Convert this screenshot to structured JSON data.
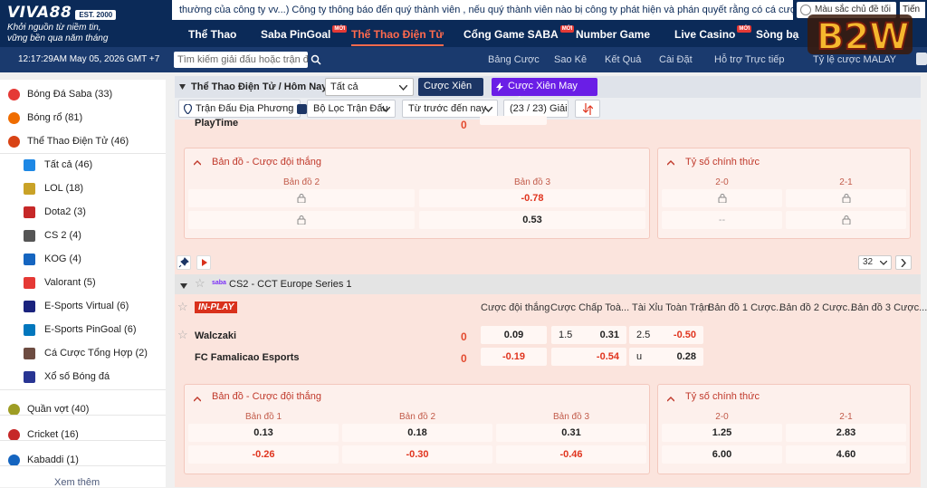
{
  "header": {
    "logo": "VIVA88",
    "logo_est": "EST. 2000",
    "tagline_1": "Khởi nguồn từ niềm tin,",
    "tagline_2": "vững bền qua năm tháng",
    "marquee": "thường của công ty vv...) Công ty thông báo đến quý thành viên , nếu quý thành viên nào bị công ty phát hiện và phán quyết rằng có cá cược bất",
    "mode_toggle": "Màu sắc chủ đề tối",
    "lang": "Tiến",
    "new_badge": "MỚI",
    "nav": [
      {
        "label": "Thể Thao",
        "new": false
      },
      {
        "label": "Saba PinGoal",
        "new": true
      },
      {
        "label": "Thể Thao Điện Tử",
        "new": false
      },
      {
        "label": "Cổng Game SABA",
        "new": true
      },
      {
        "label": "Number Game",
        "new": false
      },
      {
        "label": "Live Casino",
        "new": true
      },
      {
        "label": "Sòng bạ",
        "new": false
      }
    ]
  },
  "subbar": {
    "clock": "12:17:29AM May 05, 2026 GMT +7",
    "search_placeholder": "Tìm kiếm giải đấu hoặc trận đấu",
    "tools": [
      "Bảng Cược",
      "Sao Kê",
      "Kết Quả",
      "Cài Đặt",
      "Hỗ trợ Trực tiếp",
      "Tỷ lệ cược MALAY"
    ]
  },
  "emblem": {
    "text": "B2W"
  },
  "sidebar": {
    "items": [
      {
        "label": "Bóng Đá Saba (33)",
        "level": "top",
        "color": "#e53935"
      },
      {
        "label": "Bóng rổ (81)",
        "level": "top",
        "color": "#ef6c00"
      },
      {
        "label": "Thể Thao Điện Tử (46)",
        "level": "top",
        "color": "#d84315"
      },
      {
        "label": "Tất cả (46)",
        "level": "sub",
        "color": "#1e88e5"
      },
      {
        "label": "LOL (18)",
        "level": "sub",
        "color": "#c9a227"
      },
      {
        "label": "Dota2 (3)",
        "level": "sub",
        "color": "#c62828"
      },
      {
        "label": "CS 2 (4)",
        "level": "sub",
        "color": "#555555"
      },
      {
        "label": "KOG (4)",
        "level": "sub",
        "color": "#1565c0"
      },
      {
        "label": "Valorant (5)",
        "level": "sub",
        "color": "#e53935"
      },
      {
        "label": "E-Sports Virtual (6)",
        "level": "sub",
        "color": "#1a237e"
      },
      {
        "label": "E-Sports PinGoal (6)",
        "level": "sub",
        "color": "#0277bd"
      },
      {
        "label": "Cá Cược Tổng Hợp (2)",
        "level": "sub",
        "color": "#6d4c41"
      },
      {
        "label": "Xổ số Bóng đá",
        "level": "sub",
        "color": "#283593"
      },
      {
        "label": "Quần vợt (40)",
        "level": "top",
        "color": "#9e9d24"
      },
      {
        "label": "Cricket (16)",
        "level": "top",
        "color": "#c62828"
      },
      {
        "label": "Kabaddi (1)",
        "level": "top",
        "color": "#1565c0"
      }
    ],
    "see_more": "Xem thêm"
  },
  "main": {
    "breadcrumb": "Thể Thao Điện Tử / Hôm Nay",
    "filter_select": "Tất cả",
    "parlay_btn": "Cược Xiên",
    "lucky_parlay_btn": "Cược Xiên May Mắn",
    "filters": {
      "local": "Trận Đấu Địa Phương",
      "match_filter": "Bộ Lọc Trận Đấu",
      "sort": "Từ trước đến nay",
      "count": "(23 / 23) Giải"
    },
    "match1": {
      "team": "PlayTime",
      "score": "0",
      "card_map": {
        "title": "Bản đồ - Cược đội thắng",
        "heads": [
          "Bản đồ 2",
          "Bản đồ 3"
        ],
        "row1": [
          "",
          "-0.78"
        ],
        "row2": [
          "",
          "0.53"
        ]
      },
      "card_score": {
        "title": "Tỷ số chính thức",
        "heads": [
          "2-0",
          "2-1"
        ],
        "row1": [
          "",
          ""
        ],
        "row2": [
          "--",
          ""
        ]
      }
    },
    "pager": "32",
    "league": {
      "name": "CS2 - CCT Europe Series 1",
      "badge": "saba"
    },
    "match2": {
      "status": "IN-PLAY",
      "columns": [
        "Cược đội thắng",
        "Cược Chấp Toà...",
        "Tài Xỉu Toàn Trận",
        "Bản đồ 1 Cược...",
        "Bản đồ 2 Cược...",
        "Bản đồ 3 Cược..."
      ],
      "home": {
        "name": "Walczaki",
        "score": "0",
        "ml": "0.09",
        "hdp_line": "1.5",
        "hdp": "0.31",
        "ou_line": "2.5",
        "ou": "-0.50"
      },
      "away": {
        "name": "FC Famalicao Esports",
        "score": "0",
        "ml": "-0.19",
        "hdp_line": "",
        "hdp": "-0.54",
        "ou_line": "u",
        "ou": "0.28"
      },
      "card_map": {
        "title": "Bản đồ - Cược đội thắng",
        "heads": [
          "Bản đồ 1",
          "Bản đồ 2",
          "Bản đồ 3"
        ],
        "row1": [
          "0.13",
          "0.18",
          "0.31"
        ],
        "row2": [
          "-0.26",
          "-0.30",
          "-0.46"
        ]
      },
      "card_score": {
        "title": "Tỷ số chính thức",
        "heads": [
          "2-0",
          "2-1"
        ],
        "row1": [
          "1.25",
          "2.83"
        ],
        "row2": [
          "6.00",
          "4.60"
        ]
      }
    }
  }
}
